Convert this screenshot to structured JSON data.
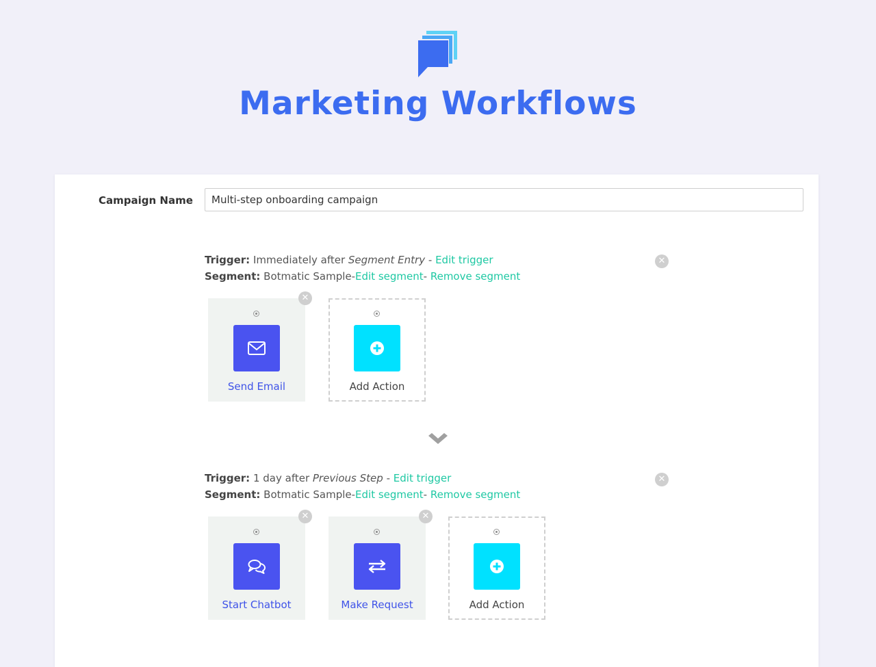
{
  "header": {
    "title": "Marketing Workflows"
  },
  "colors": {
    "accent": "#3c6cf0",
    "link": "#1ec8a3",
    "action": "#4a53f0",
    "add": "#00e1ff"
  },
  "campaign": {
    "label": "Campaign Name",
    "value": "Multi-step onboarding campaign"
  },
  "steps": [
    {
      "trigger_label": "Trigger:",
      "trigger_text": "Immediately after",
      "trigger_event": "Segment Entry",
      "trigger_sep": "-",
      "edit_trigger": "Edit trigger",
      "segment_label": "Segment:",
      "segment_name": "Botmatic Sample-",
      "edit_segment": "Edit segment",
      "segment_sep": "-",
      "remove_segment": "Remove segment",
      "actions": [
        {
          "label": "Send Email",
          "icon": "envelope-icon"
        },
        {
          "label": "Add Action",
          "icon": "plus-circle-icon"
        }
      ]
    },
    {
      "trigger_label": "Trigger:",
      "trigger_text": "1 day after",
      "trigger_event": "Previous Step",
      "trigger_sep": "-",
      "edit_trigger": "Edit trigger",
      "segment_label": "Segment:",
      "segment_name": "Botmatic Sample-",
      "edit_segment": "Edit segment",
      "segment_sep": "-",
      "remove_segment": "Remove segment",
      "actions": [
        {
          "label": "Start Chatbot",
          "icon": "chat-bubbles-icon"
        },
        {
          "label": "Make Request",
          "icon": "exchange-arrows-icon"
        },
        {
          "label": "Add Action",
          "icon": "plus-circle-icon"
        }
      ]
    }
  ]
}
